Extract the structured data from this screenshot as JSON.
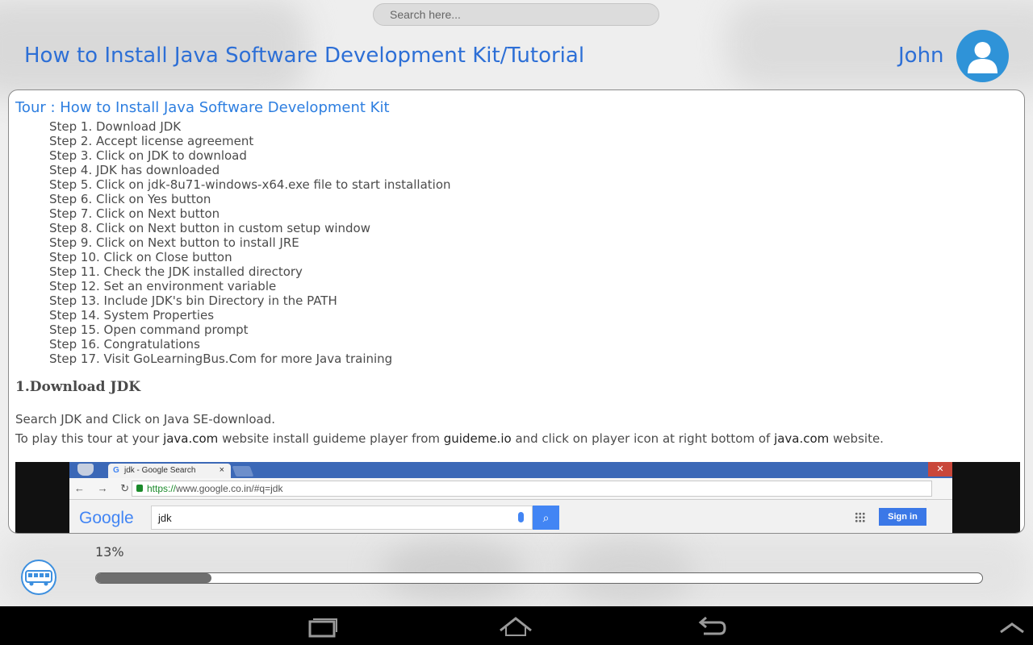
{
  "search": {
    "placeholder": "Search here..."
  },
  "header": {
    "title": "How to Install Java Software Development Kit/Tutorial",
    "user_name": "John"
  },
  "tour": {
    "title": "Tour : How to Install Java Software Development Kit",
    "steps": [
      "Step 1. Download JDK",
      "Step 2. Accept license agreement",
      "Step 3. Click on JDK to download",
      "Step 4. JDK has downloaded",
      "Step 5. Click on jdk-8u71-windows-x64.exe file to start installation",
      "Step 6. Click on Yes button",
      "Step 7. Click on Next button",
      "Step 8. Click on Next button in custom setup window",
      "Step 9. Click on Next button to install JRE",
      "Step 10. Click on Close button",
      "Step 11. Check the JDK installed directory",
      "Step 12. Set an environment variable",
      "Step 13. Include JDK's bin Directory in the PATH",
      "Step 14. System Properties",
      "Step 15. Open command prompt",
      "Step 16. Congratulations",
      "Step 17. Visit GoLearningBus.Com for more Java training"
    ]
  },
  "section": {
    "heading": "1.Download JDK",
    "para1": "Search JDK and Click on Java SE-download.",
    "para2": {
      "t1": "To play this tour at your ",
      "link1": "java.com",
      "t2": " website install guideme player from ",
      "link2": "guideme.io",
      "t3": " and click on player icon at right bottom of ",
      "link3": "java.com",
      "t4": " website."
    }
  },
  "screenshot": {
    "tab_title": "jdk - Google Search",
    "tab_close": "×",
    "url_secure": "https://",
    "url_rest": "www.google.co.in/#q=jdk",
    "logo": "Google",
    "query": "jdk",
    "signin": "Sign in"
  },
  "progress": {
    "label": "13%",
    "value": 0.13
  },
  "colors": {
    "accent": "#2d6fd6",
    "avatar": "#2f93d8",
    "progress_fill": "#6e6e6e"
  },
  "icons": {
    "avatar": "user-icon",
    "bus": "bus-icon",
    "nav": [
      "recent-apps-icon",
      "home-icon",
      "back-icon",
      "chevron-up-icon"
    ]
  }
}
